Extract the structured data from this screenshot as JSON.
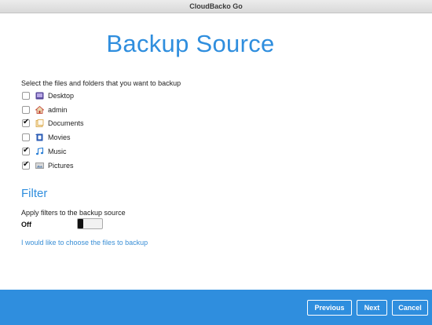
{
  "window": {
    "title": "CloudBacko Go"
  },
  "page": {
    "title": "Backup Source",
    "instruction": "Select the files and folders that you want to backup"
  },
  "sources": [
    {
      "label": "Desktop",
      "checked": false,
      "icon": "desktop-icon",
      "icon_color": "#5a4a9c"
    },
    {
      "label": "admin",
      "checked": false,
      "icon": "home-icon",
      "icon_color": "#c0392b"
    },
    {
      "label": "Documents",
      "checked": true,
      "icon": "documents-icon",
      "icon_color": "#d9a441"
    },
    {
      "label": "Movies",
      "checked": false,
      "icon": "movies-icon",
      "icon_color": "#2a5bb5"
    },
    {
      "label": "Music",
      "checked": true,
      "icon": "music-icon",
      "icon_color": "#2a7fd6"
    },
    {
      "label": "Pictures",
      "checked": true,
      "icon": "pictures-icon",
      "icon_color": "#8a8a8a"
    }
  ],
  "filter": {
    "heading": "Filter",
    "description": "Apply filters to the backup source",
    "toggle_state": "Off",
    "toggle_on": false
  },
  "choose_files_link": "I would like to choose the files to backup",
  "footer": {
    "previous": "Previous",
    "next": "Next",
    "cancel": "Cancel"
  },
  "colors": {
    "accent": "#2f8ede",
    "footer": "#2f8ede",
    "link": "#3a8fd6"
  }
}
